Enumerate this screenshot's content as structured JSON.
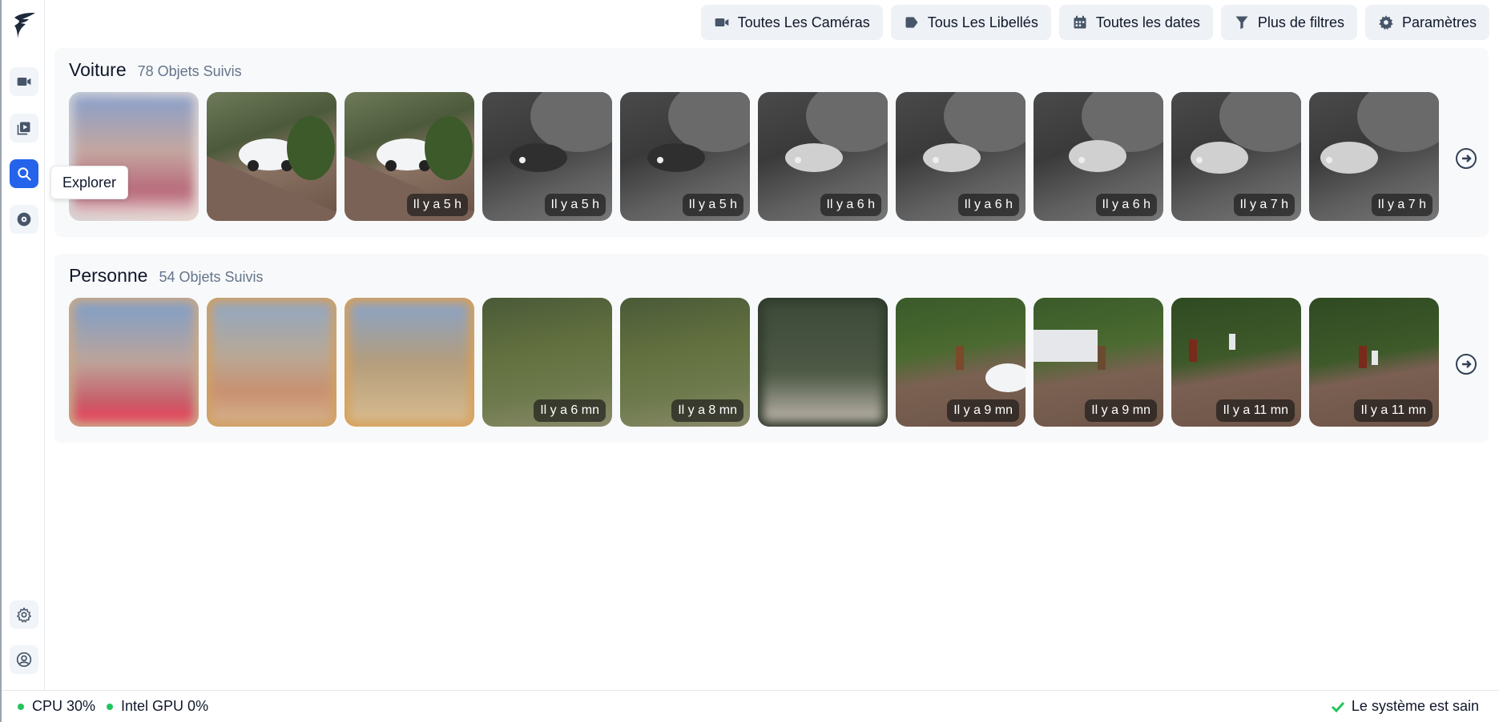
{
  "sidebar": {
    "tooltip": "Explorer",
    "items": [
      {
        "name": "live-cameras",
        "icon": "video-icon"
      },
      {
        "name": "review",
        "icon": "play-library-icon"
      },
      {
        "name": "explore",
        "icon": "search-icon",
        "active": true
      },
      {
        "name": "export",
        "icon": "disc-icon"
      }
    ],
    "bottom_items": [
      {
        "name": "settings",
        "icon": "gear-icon"
      },
      {
        "name": "account",
        "icon": "user-circle-icon"
      }
    ]
  },
  "filters": {
    "cameras": "Toutes Les Caméras",
    "labels": "Tous Les Libellés",
    "dates": "Toutes les dates",
    "more": "Plus de filtres",
    "settings": "Paramètres"
  },
  "sections": [
    {
      "title": "Voiture",
      "count": "78 Objets Suivis",
      "thumbnails": [
        {
          "time": ""
        },
        {
          "time": ""
        },
        {
          "time": "Il y a 5 h"
        },
        {
          "time": "Il y a 5 h"
        },
        {
          "time": "Il y a 5 h"
        },
        {
          "time": "Il y a 6 h"
        },
        {
          "time": "Il y a 6 h"
        },
        {
          "time": "Il y a 6 h"
        },
        {
          "time": "Il y a 7 h"
        },
        {
          "time": "Il y a 7 h"
        }
      ]
    },
    {
      "title": "Personne",
      "count": "54 Objets Suivis",
      "thumbnails": [
        {
          "time": ""
        },
        {
          "time": ""
        },
        {
          "time": ""
        },
        {
          "time": "Il y a 6 mn"
        },
        {
          "time": "Il y a 8 mn"
        },
        {
          "time": ""
        },
        {
          "time": "Il y a 9 mn"
        },
        {
          "time": "Il y a 9 mn"
        },
        {
          "time": "Il y a 11 mn"
        },
        {
          "time": "Il y a 11 mn"
        }
      ]
    }
  ],
  "footer": {
    "cpu": "CPU 30%",
    "gpu": "Intel GPU 0%",
    "status": "Le système est sain"
  },
  "colors": {
    "accent": "#2563eb",
    "healthy": "#22c55e"
  }
}
